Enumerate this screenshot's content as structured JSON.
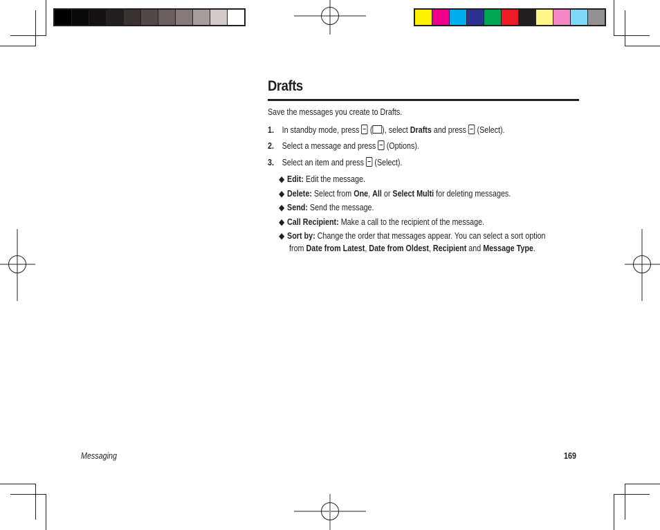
{
  "page": {
    "title": "Drafts",
    "intro": "Save the messages you create to Drafts.",
    "steps": [
      {
        "num": "1.",
        "parts": [
          "In standby mode, press ",
          " (",
          "), select ",
          "Drafts",
          " and press ",
          " (Select)."
        ]
      },
      {
        "num": "2.",
        "parts": [
          "Select a message and press ",
          " (Options)."
        ]
      },
      {
        "num": "3.",
        "parts": [
          "Select an item and press ",
          " (Select)."
        ]
      }
    ],
    "options": [
      {
        "label": "Edit:",
        "text": " Edit the message."
      },
      {
        "label": "Delete:",
        "text_a": " Select from ",
        "b1": "One",
        "sep1": ", ",
        "b2": "All",
        "sep2": " or ",
        "b3": "Select Multi",
        "text_b": " for deleting messages."
      },
      {
        "label": "Send:",
        "text": " Send the message."
      },
      {
        "label": "Call Recipient:",
        "text": " Make a call to the recipient of the message."
      },
      {
        "label": "Sort by:",
        "line1": " Change the order that messages appear. You can select a sort option",
        "line2_a": "from ",
        "b1": "Date from Latest",
        "sep1": ", ",
        "b2": "Date from Oldest",
        "sep2": ", ",
        "b3": "Recipient",
        "sep3": " and ",
        "b4": "Message Type",
        "end": "."
      }
    ],
    "bullet": "◆"
  },
  "footer": {
    "section": "Messaging",
    "page_number": "169"
  },
  "print_marks": {
    "grayscale_swatches": [
      "#000000",
      "#0a0909",
      "#151212",
      "#231f1e",
      "#3a3230",
      "#524845",
      "#6a5f5c",
      "#857a77",
      "#a69c99",
      "#d3cac8",
      "#ffffff"
    ],
    "color_swatches": [
      "#fff200",
      "#ec008c",
      "#00aeef",
      "#2e3192",
      "#00a651",
      "#ed1c24",
      "#231f20",
      "#fff685",
      "#f587c5",
      "#7fd8f7",
      "#939191"
    ]
  }
}
